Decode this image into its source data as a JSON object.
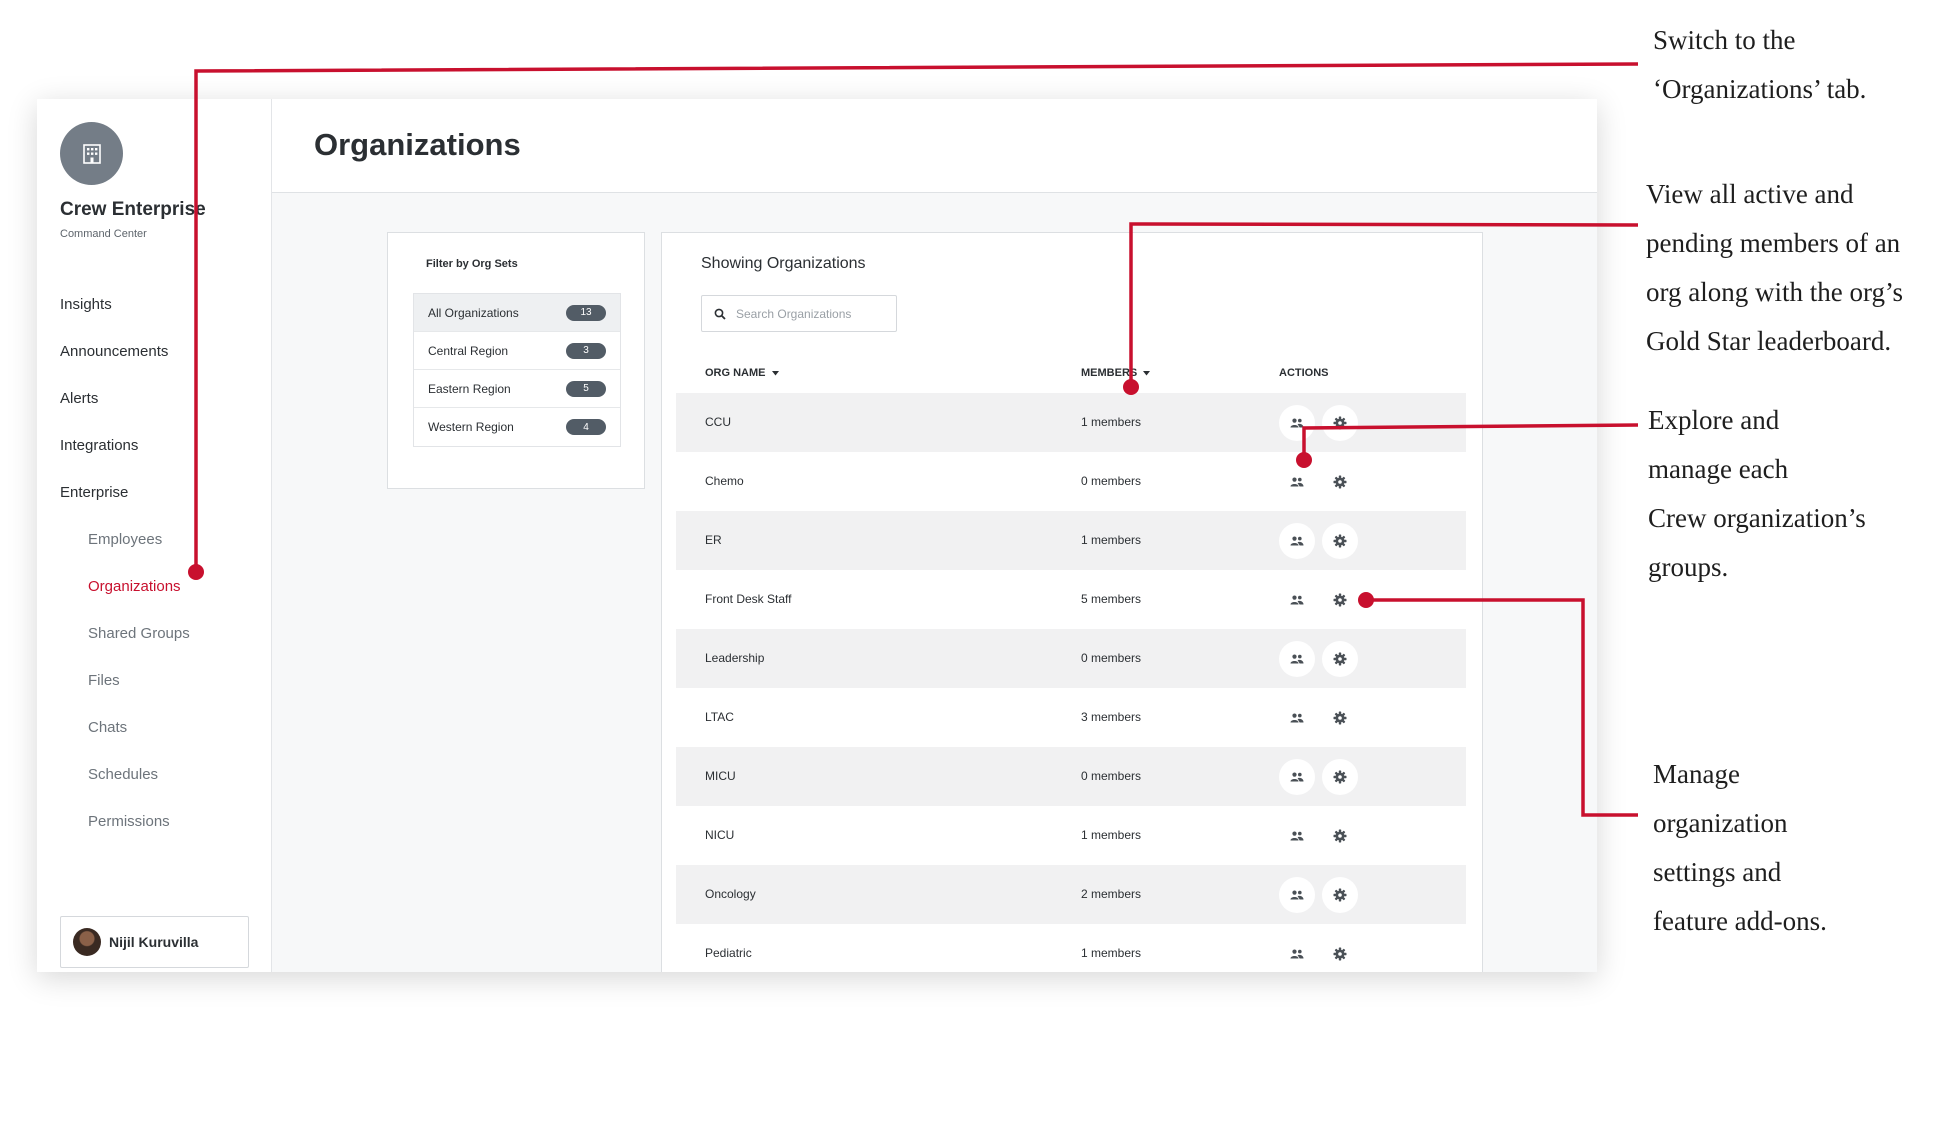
{
  "brand": {
    "name": "Crew Enterprise",
    "subtitle": "Command Center"
  },
  "nav": {
    "items": [
      {
        "label": "Insights"
      },
      {
        "label": "Announcements"
      },
      {
        "label": "Alerts"
      },
      {
        "label": "Integrations"
      },
      {
        "label": "Enterprise"
      }
    ],
    "sub_items": [
      {
        "label": "Employees"
      },
      {
        "label": "Organizations",
        "active": true
      },
      {
        "label": "Shared Groups"
      },
      {
        "label": "Files"
      },
      {
        "label": "Chats"
      },
      {
        "label": "Schedules"
      },
      {
        "label": "Permissions"
      }
    ]
  },
  "user": {
    "name": "Nijil Kuruvilla"
  },
  "page": {
    "title": "Organizations"
  },
  "filter": {
    "title": "Filter by Org Sets",
    "items": [
      {
        "label": "All Organizations",
        "count": "13",
        "selected": true
      },
      {
        "label": "Central Region",
        "count": "3"
      },
      {
        "label": "Eastern Region",
        "count": "5"
      },
      {
        "label": "Western Region",
        "count": "4"
      }
    ]
  },
  "orgs": {
    "heading": "Showing Organizations",
    "search_placeholder": "Search Organizations",
    "columns": {
      "name": "ORG NAME",
      "members": "MEMBERS",
      "actions": "ACTIONS"
    },
    "rows": [
      {
        "name": "CCU",
        "members": "1 members"
      },
      {
        "name": "Chemo",
        "members": "0 members"
      },
      {
        "name": "ER",
        "members": "1 members"
      },
      {
        "name": "Front Desk Staff",
        "members": "5 members"
      },
      {
        "name": "Leadership",
        "members": "0 members"
      },
      {
        "name": "LTAC",
        "members": "3 members"
      },
      {
        "name": "MICU",
        "members": "0 members"
      },
      {
        "name": "NICU",
        "members": "1 members"
      },
      {
        "name": "Oncology",
        "members": "2 members"
      },
      {
        "name": "Pediatric",
        "members": "1 members"
      }
    ]
  },
  "callouts": {
    "tab": [
      "Switch to the",
      "‘Organizations’ tab."
    ],
    "members": [
      "View all active and",
      "pending members of an",
      "org along with the org’s",
      "Gold Star leaderboard."
    ],
    "groups": [
      "Explore and",
      "manage each",
      "Crew organization’s",
      "groups."
    ],
    "settings": [
      "Manage",
      "organization",
      "settings and",
      "feature add-ons."
    ]
  },
  "colors": {
    "accent": "#c8102e",
    "badge": "#525c66",
    "logo": "#747d87"
  },
  "icons": {
    "logo": "building-icon",
    "search": "search-icon",
    "members": "people-icon",
    "settings": "gear-icon",
    "sort": "caret-down-icon"
  }
}
